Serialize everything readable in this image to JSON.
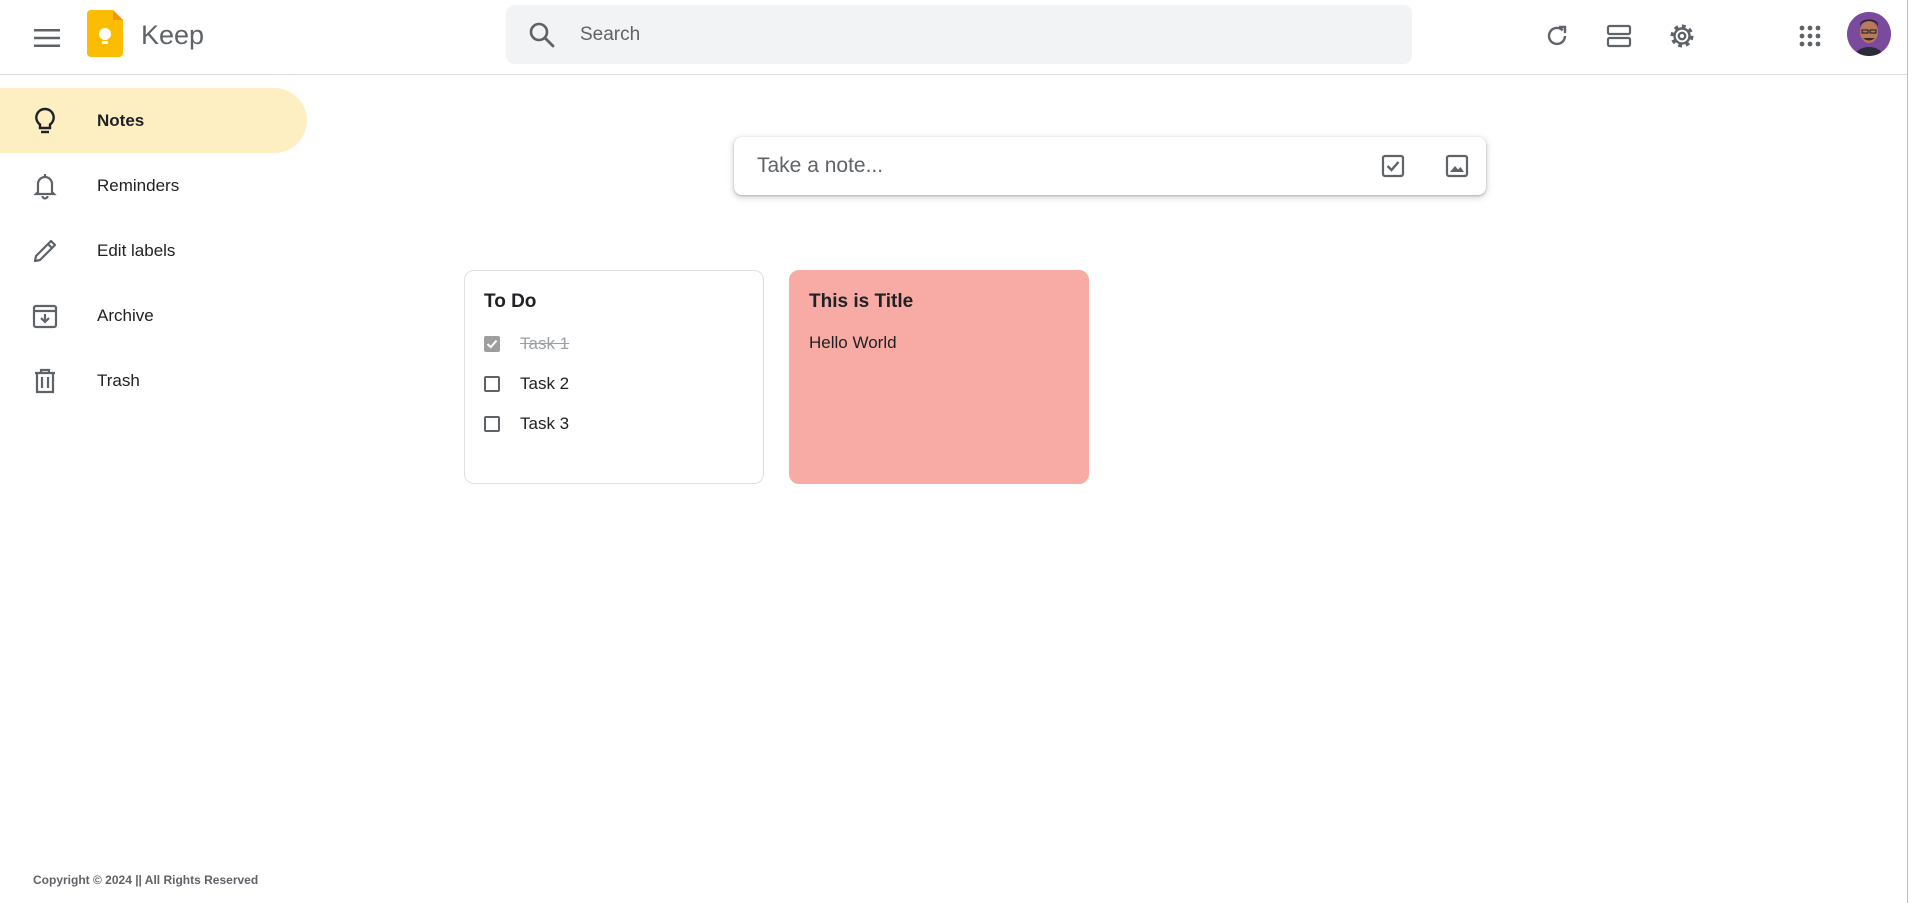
{
  "header": {
    "app_name": "Keep",
    "search_placeholder": "Search"
  },
  "sidebar": {
    "items": [
      {
        "label": "Notes",
        "icon": "lightbulb-icon",
        "active": true
      },
      {
        "label": "Reminders",
        "icon": "bell-icon"
      },
      {
        "label": "Edit labels",
        "icon": "pencil-icon"
      },
      {
        "label": "Archive",
        "icon": "archive-icon"
      },
      {
        "label": "Trash",
        "icon": "trash-icon"
      }
    ]
  },
  "take_note": {
    "placeholder": "Take a note..."
  },
  "notes": [
    {
      "title": "To Do",
      "tasks": [
        {
          "label": "Task 1",
          "checked": true
        },
        {
          "label": "Task 2",
          "checked": false
        },
        {
          "label": "Task 3",
          "checked": false
        }
      ],
      "color": "#ffffff"
    },
    {
      "title": "This is Title",
      "body": "Hello World",
      "color": "#f8aba4"
    }
  ],
  "footer": {
    "text": "Copyright © 2024 || All Rights Reserved"
  },
  "colors": {
    "accent_active": "#feefc3",
    "logo_yellow": "#fbbc04"
  }
}
